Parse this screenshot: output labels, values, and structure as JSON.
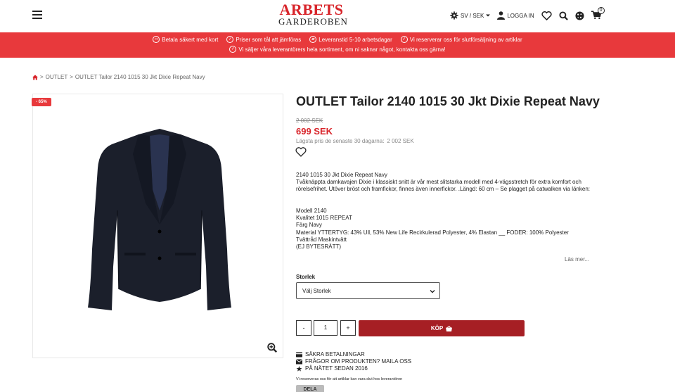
{
  "header": {
    "logo_top": "ARBETS",
    "logo_bottom": "GARDEROBEN",
    "lang_currency": "SV / SEK",
    "login": "LOGGA IN",
    "cart_count": "0"
  },
  "banner": {
    "items_row1": [
      "Betala säkert med kort",
      "Priser som tål att jämföras",
      "Leveranstid 5-10 arbetsdagar",
      "Vi reserverar oss för slutförsäljning av artiklar"
    ],
    "item_row2": "Vi säljer våra leverantörers hela sortiment, om ni saknar något, kontakta oss gärna!"
  },
  "breadcrumb": {
    "sep": ">",
    "level1": "OUTLET",
    "level2": "OUTLET Tailor 2140 1015 30 Jkt Dixie Repeat Navy"
  },
  "product": {
    "badge": "- 65%",
    "title": "OUTLET Tailor 2140 1015 30 Jkt Dixie Repeat Navy",
    "old_price": "2 002 SEK",
    "new_price": "699 SEK",
    "lowest_label": "Lägsta pris de senaste 30 dagarna:",
    "lowest_value": "2 002 SEK",
    "desc_line1": "2140 1015 30 Jkt Dixie Repeat Navy",
    "desc_line2": "Tvåknäppta damkavajen Dixie i klassiskt snitt är vår mest slitstarka modell med 4-vägsstretch för extra komfort och rörelsefrihet. Utöver bröst och framfickor, finnes även innerfickor. .Längd: 60 cm – Se plagget på catwalken via länken:",
    "spec1": "Modell 2140",
    "spec2": "Kvalitet 1015 REPEAT",
    "spec3": "Färg Navy",
    "spec4": "Material YTTERTYG: 43% Ull, 53% New Life Recirkulerad Polyester, 4% Elastan __ FODER: 100% Polyester",
    "spec5": "Tvättråd Maskintvätt",
    "spec6": "(EJ BYTESRÄTT)",
    "read_more": "Läs mer...",
    "size_label": "Storlek",
    "size_placeholder": "Välj Storlek",
    "qty_minus": "-",
    "qty_value": "1",
    "qty_plus": "+",
    "buy_label": "KÖP"
  },
  "trust": {
    "line1": "SÄKRA BETALNINGAR",
    "line2": "FRÅGOR OM PRODUKTEN? MAILA OSS",
    "line3": "PÅ NÄTET SEDAN 2016",
    "note": "Vi reserveras oss för att artiklar kan vara slut hos leverantören",
    "share": "DELA"
  },
  "colors": {
    "brand_red": "#e8393c",
    "buy_red": "#a61f24",
    "price_red": "#d8242a"
  }
}
